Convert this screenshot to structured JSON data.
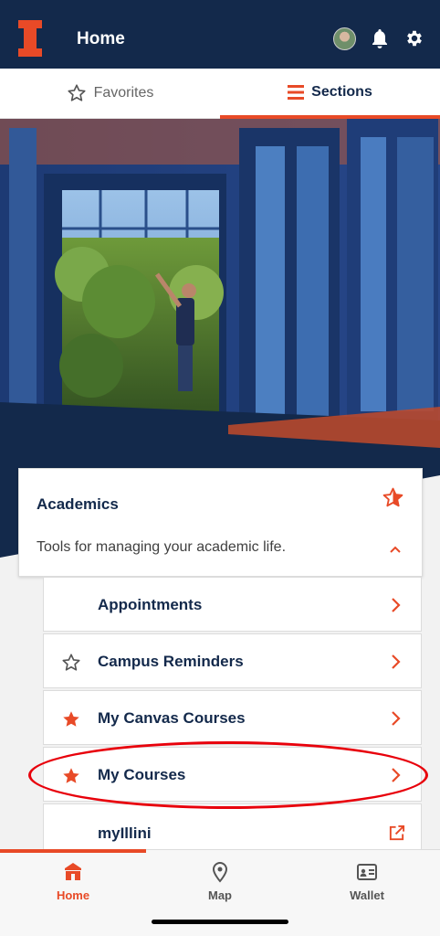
{
  "header": {
    "title": "Home"
  },
  "tabs": {
    "favorites": "Favorites",
    "sections": "Sections"
  },
  "section": {
    "title": "Academics",
    "description": "Tools for managing your academic life.",
    "items": [
      {
        "label": "Appointments",
        "favorite": "none"
      },
      {
        "label": "Campus Reminders",
        "favorite": "off"
      },
      {
        "label": "My Canvas Courses",
        "favorite": "on"
      },
      {
        "label": "My Courses",
        "favorite": "on",
        "highlighted": true
      },
      {
        "label": "myIllini",
        "favorite": "none",
        "external": true
      }
    ]
  },
  "bottom_nav": [
    {
      "label": "Home",
      "icon": "home-icon",
      "active": true
    },
    {
      "label": "Map",
      "icon": "map-pin-icon",
      "active": false
    },
    {
      "label": "Wallet",
      "icon": "wallet-icon",
      "active": false
    }
  ],
  "colors": {
    "navy": "#13294b",
    "orange": "#e84a27",
    "highlight": "#e8000b"
  }
}
